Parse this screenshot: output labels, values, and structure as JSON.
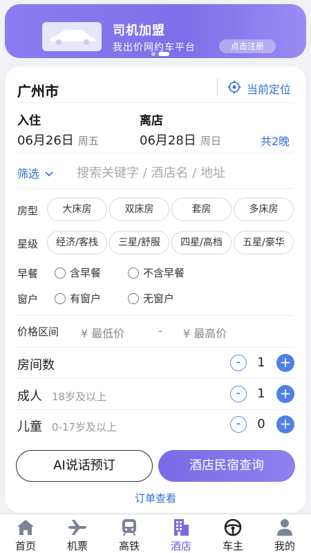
{
  "banner": {
    "title": "司机加盟",
    "subtitle": "我出价网约车平台",
    "cta": "点击注册"
  },
  "location": {
    "city": "广州市",
    "current_location": "当前定位"
  },
  "dates": {
    "checkin_label": "入住",
    "checkin_date": "06月26日",
    "checkin_weekday": "周五",
    "checkout_label": "离店",
    "checkout_date": "06月28日",
    "checkout_weekday": "周日",
    "nights": "共2晚"
  },
  "search": {
    "filter_label": "筛选",
    "placeholder": "搜索关键字 / 酒店名 / 地址"
  },
  "room_type": {
    "label": "房型",
    "options": [
      "大床房",
      "双床房",
      "套房",
      "多床房"
    ]
  },
  "star_level": {
    "label": "星级",
    "options": [
      "经济/客栈",
      "三星/舒服",
      "四星/高档",
      "五星/豪华"
    ]
  },
  "breakfast": {
    "label": "早餐",
    "options": [
      "含早餐",
      "不含早餐"
    ]
  },
  "window": {
    "label": "窗户",
    "options": [
      "有窗户",
      "无窗户"
    ]
  },
  "price": {
    "label": "价格区间",
    "min_placeholder": "¥  最低价",
    "separator": "-",
    "max_placeholder": "¥  最高价"
  },
  "counters": {
    "rooms": {
      "label": "房间数",
      "value": "1"
    },
    "adults": {
      "label": "成人",
      "sub": "18岁及以上",
      "value": "1"
    },
    "children": {
      "label": "儿童",
      "sub": "0-17岁及以上",
      "value": "0"
    },
    "minus": "-",
    "plus": "+"
  },
  "actions": {
    "ai_booking": "AI说话预订",
    "search": "酒店民宿查询",
    "orders": "订单查看"
  },
  "tabs": [
    {
      "label": "首页",
      "icon": "home-icon"
    },
    {
      "label": "机票",
      "icon": "plane-icon"
    },
    {
      "label": "高铁",
      "icon": "train-icon"
    },
    {
      "label": "酒店",
      "icon": "hotel-icon",
      "active": true
    },
    {
      "label": "车主",
      "icon": "steering-wheel-icon"
    },
    {
      "label": "我的",
      "icon": "user-icon"
    }
  ],
  "colors": {
    "accent_blue": "#2f6fd8",
    "accent_purple": "#7a6ae6",
    "active_tab": "#6a5ae0"
  }
}
